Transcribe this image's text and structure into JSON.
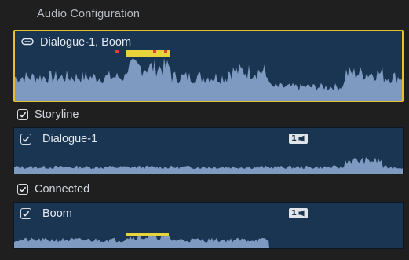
{
  "panel": {
    "title": "Audio Configuration"
  },
  "main_clip": {
    "title": "Dialogue-1, Boom",
    "selected": true,
    "icon": "linked-clip-icon"
  },
  "sections": [
    {
      "label": "Storyline",
      "checked": true,
      "clip": {
        "title": "Dialogue-1",
        "checked": true,
        "channels": "1",
        "icon": "mono-channel-icon"
      }
    },
    {
      "label": "Connected",
      "checked": true,
      "clip": {
        "title": "Boom",
        "checked": true,
        "channels": "1",
        "icon": "mono-channel-icon"
      }
    }
  ],
  "colors": {
    "clip_bg": "#1a3552",
    "waveform": "#7f9ac0",
    "selection": "#e6c02a",
    "peak_yellow": "#e8d33a",
    "peak_red": "#e0423a"
  }
}
